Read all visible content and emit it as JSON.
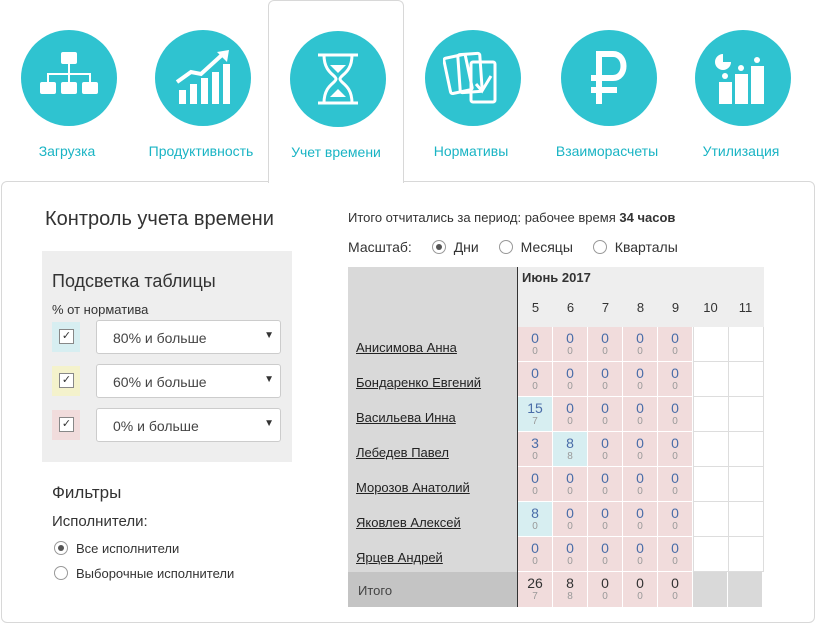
{
  "tabs": [
    {
      "label": "Загрузка",
      "icon": "hierarchy-icon",
      "active": false
    },
    {
      "label": "Продуктивность",
      "icon": "growth-chart-icon",
      "active": false
    },
    {
      "label": "Учет времени",
      "icon": "hourglass-icon",
      "active": true
    },
    {
      "label": "Нормативы",
      "icon": "cards-check-icon",
      "active": false
    },
    {
      "label": "Взаиморасчеты",
      "icon": "ruble-icon",
      "active": false
    },
    {
      "label": "Утилизация",
      "icon": "utilization-icon",
      "active": false
    }
  ],
  "accent_color": "#2fc3d0",
  "page_title": "Контроль учета времени",
  "highlight": {
    "title": "Подсветка таблицы",
    "subtitle": "% от норматива",
    "rows": [
      {
        "value": "80% и больше",
        "checked": true,
        "color": "#d7eef1"
      },
      {
        "value": "60% и больше",
        "checked": true,
        "color": "#f4f2cc"
      },
      {
        "value": "0% и больше",
        "checked": true,
        "color": "#f1dcdc"
      }
    ]
  },
  "filters": {
    "title": "Фильтры",
    "executors_label": "Исполнители:",
    "options": [
      {
        "label": "Все исполнители",
        "selected": true
      },
      {
        "label": "Выборочные исполнители",
        "selected": false
      }
    ]
  },
  "summary": {
    "prefix": "Итого отчитались за период: рабочее время",
    "value": "34 часов"
  },
  "scale": {
    "label": "Масштаб:",
    "options": [
      {
        "label": "Дни",
        "selected": true
      },
      {
        "label": "Месяцы",
        "selected": false
      },
      {
        "label": "Кварталы",
        "selected": false
      }
    ]
  },
  "table": {
    "month": "Июнь 2017",
    "days": [
      "5",
      "6",
      "7",
      "8",
      "9",
      "10",
      "11"
    ],
    "rows": [
      {
        "name": "Анисимова Анна",
        "cells": [
          [
            "0",
            "0"
          ],
          [
            "0",
            "0"
          ],
          [
            "0",
            "0"
          ],
          [
            "0",
            "0"
          ],
          [
            "0",
            "0"
          ]
        ]
      },
      {
        "name": "Бондаренко Евгений",
        "cells": [
          [
            "0",
            "0"
          ],
          [
            "0",
            "0"
          ],
          [
            "0",
            "0"
          ],
          [
            "0",
            "0"
          ],
          [
            "0",
            "0"
          ]
        ]
      },
      {
        "name": "Васильева Инна",
        "cells": [
          [
            "15",
            "7"
          ],
          [
            "0",
            "0"
          ],
          [
            "0",
            "0"
          ],
          [
            "0",
            "0"
          ],
          [
            "0",
            "0"
          ]
        ]
      },
      {
        "name": "Лебедев Павел",
        "cells": [
          [
            "3",
            "0"
          ],
          [
            "8",
            "8"
          ],
          [
            "0",
            "0"
          ],
          [
            "0",
            "0"
          ],
          [
            "0",
            "0"
          ]
        ]
      },
      {
        "name": "Морозов Анатолий",
        "cells": [
          [
            "0",
            "0"
          ],
          [
            "0",
            "0"
          ],
          [
            "0",
            "0"
          ],
          [
            "0",
            "0"
          ],
          [
            "0",
            "0"
          ]
        ]
      },
      {
        "name": "Яковлев Алексей",
        "cells": [
          [
            "8",
            "0"
          ],
          [
            "0",
            "0"
          ],
          [
            "0",
            "0"
          ],
          [
            "0",
            "0"
          ],
          [
            "0",
            "0"
          ]
        ]
      },
      {
        "name": "Ярцев Андрей",
        "cells": [
          [
            "0",
            "0"
          ],
          [
            "0",
            "0"
          ],
          [
            "0",
            "0"
          ],
          [
            "0",
            "0"
          ],
          [
            "0",
            "0"
          ]
        ]
      }
    ],
    "cell_colors": [
      [
        "pink",
        "pink",
        "pink",
        "pink",
        "pink"
      ],
      [
        "pink",
        "pink",
        "pink",
        "pink",
        "pink"
      ],
      [
        "blue",
        "pink",
        "pink",
        "pink",
        "pink"
      ],
      [
        "pink",
        "blue",
        "pink",
        "pink",
        "pink"
      ],
      [
        "pink",
        "pink",
        "pink",
        "pink",
        "pink"
      ],
      [
        "blue",
        "pink",
        "pink",
        "pink",
        "pink"
      ],
      [
        "pink",
        "pink",
        "pink",
        "pink",
        "pink"
      ]
    ],
    "total_label": "Итого",
    "totals": [
      [
        "26",
        "7"
      ],
      [
        "8",
        "8"
      ],
      [
        "0",
        "0"
      ],
      [
        "0",
        "0"
      ],
      [
        "0",
        "0"
      ]
    ]
  }
}
